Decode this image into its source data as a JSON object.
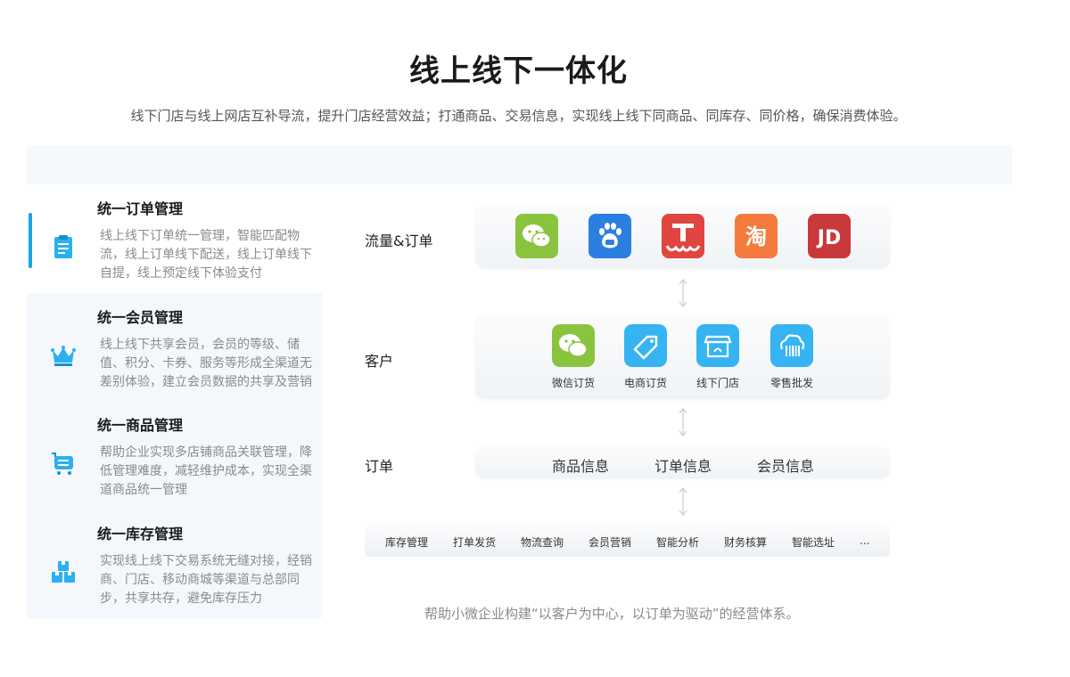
{
  "header": {
    "title": "线上线下一体化",
    "subtitle": "线下门店与线上网店互补导流，提升门店经营效益；打通商品、交易信息，实现线上线下同商品、同库存、同价格，确保消费体验。"
  },
  "features": [
    {
      "title": "统一订单管理",
      "desc": "线上线下订单统一管理，智能匹配物流，线上订单线下配送，线上订单线下自提，线上预定线下体验支付",
      "icon": "clipboard-icon",
      "active": true
    },
    {
      "title": "统一会员管理",
      "desc": "线上线下共享会员，会员的等级、储值、积分、卡券、服务等形成全渠道无差别体验，建立会员数据的共享及营销体系",
      "icon": "crown-icon",
      "active": false
    },
    {
      "title": "统一商品管理",
      "desc": "帮助企业实现多店铺商品关联管理，降低管理难度，减轻维护成本，实现全渠道商品统一管理",
      "icon": "cart-icon",
      "active": false
    },
    {
      "title": "统一库存管理",
      "desc": "实现线上线下交易系统无缝对接，经销商、门店、移动商城等渠道与总部同步，共享共存，避免库存压力",
      "icon": "boxes-icon",
      "active": false
    }
  ],
  "diagram": {
    "row_labels": {
      "flow": "流量&订单",
      "customer": "客户",
      "order": "订单"
    },
    "channels": [
      {
        "icon": "wechat-icon",
        "color": "#8ac43f"
      },
      {
        "icon": "baidu-icon",
        "color": "#2a7fe0"
      },
      {
        "icon": "tmall-icon",
        "color": "#e0453f"
      },
      {
        "icon": "taobao-icon",
        "color": "#f47a3e",
        "glyph": "淘"
      },
      {
        "icon": "jd-icon",
        "color": "#c9383a",
        "glyph": "JD"
      }
    ],
    "customer_channels": [
      {
        "label": "微信订货",
        "icon": "wechat-icon",
        "color": "#8ac43f"
      },
      {
        "label": "电商订货",
        "icon": "tag-icon",
        "color": "#36b3f2"
      },
      {
        "label": "线下门店",
        "icon": "store-icon",
        "color": "#36b3f2"
      },
      {
        "label": "零售批发",
        "icon": "cloud-barcode-icon",
        "color": "#36b3f2"
      }
    ],
    "info": [
      "商品信息",
      "订单信息",
      "会员信息"
    ],
    "services": [
      "库存管理",
      "打单发货",
      "物流查询",
      "会员营销",
      "智能分析",
      "财务核算",
      "智能选址",
      "..."
    ]
  },
  "footer": {
    "note": "帮助小微企业构建“以客户为中心，以订单为驱动”的经营体系。"
  },
  "colors": {
    "accent": "#1aa3e8",
    "icon_blue": "#36b3f2"
  }
}
